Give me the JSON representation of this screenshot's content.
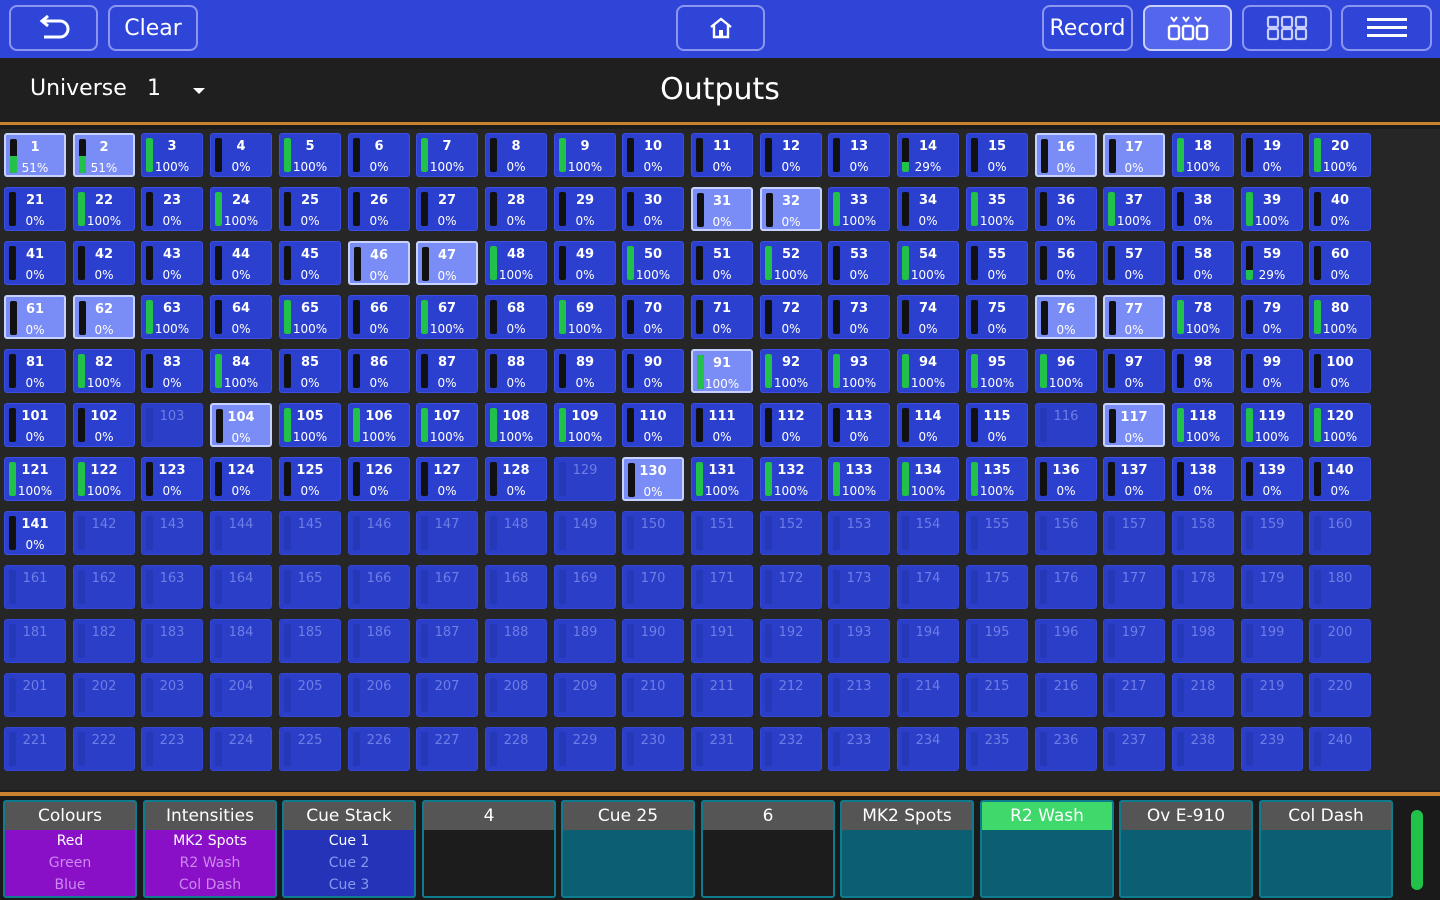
{
  "toolbar": {
    "clear_label": "Clear",
    "record_label": "Record"
  },
  "header": {
    "universe_label": "Universe",
    "universe_value": "1",
    "title": "Outputs"
  },
  "colors": {
    "toolbar": "#2f45d8",
    "cell": "#2c40cf",
    "cell_highlight": "#7a8cf5",
    "level_fill": "#22c24a",
    "accent_line": "#c9822f",
    "playback_teal": "#0c5f72",
    "playback_purple": "#8a10c8",
    "playback_blue": "#2433b8",
    "playback_active_header": "#3fd86a"
  },
  "channels": [
    {
      "n": "1",
      "p": "51%",
      "l": 0.51,
      "h": true
    },
    {
      "n": "2",
      "p": "51%",
      "l": 0.51,
      "h": true
    },
    {
      "n": "3",
      "p": "100%",
      "l": 1
    },
    {
      "n": "4",
      "p": "0%",
      "l": 0
    },
    {
      "n": "5",
      "p": "100%",
      "l": 1
    },
    {
      "n": "6",
      "p": "0%",
      "l": 0
    },
    {
      "n": "7",
      "p": "100%",
      "l": 1
    },
    {
      "n": "8",
      "p": "0%",
      "l": 0
    },
    {
      "n": "9",
      "p": "100%",
      "l": 1
    },
    {
      "n": "10",
      "p": "0%",
      "l": 0
    },
    {
      "n": "11",
      "p": "0%",
      "l": 0
    },
    {
      "n": "12",
      "p": "0%",
      "l": 0
    },
    {
      "n": "13",
      "p": "0%",
      "l": 0
    },
    {
      "n": "14",
      "p": "29%",
      "l": 0.29
    },
    {
      "n": "15",
      "p": "0%",
      "l": 0
    },
    {
      "n": "16",
      "p": "0%",
      "l": 0,
      "h": true
    },
    {
      "n": "17",
      "p": "0%",
      "l": 0,
      "h": true
    },
    {
      "n": "18",
      "p": "100%",
      "l": 1
    },
    {
      "n": "19",
      "p": "0%",
      "l": 0
    },
    {
      "n": "20",
      "p": "100%",
      "l": 1
    },
    {
      "n": "21",
      "p": "0%",
      "l": 0
    },
    {
      "n": "22",
      "p": "100%",
      "l": 1
    },
    {
      "n": "23",
      "p": "0%",
      "l": 0
    },
    {
      "n": "24",
      "p": "100%",
      "l": 1
    },
    {
      "n": "25",
      "p": "0%",
      "l": 0
    },
    {
      "n": "26",
      "p": "0%",
      "l": 0
    },
    {
      "n": "27",
      "p": "0%",
      "l": 0
    },
    {
      "n": "28",
      "p": "0%",
      "l": 0
    },
    {
      "n": "29",
      "p": "0%",
      "l": 0
    },
    {
      "n": "30",
      "p": "0%",
      "l": 0
    },
    {
      "n": "31",
      "p": "0%",
      "l": 0,
      "h": true
    },
    {
      "n": "32",
      "p": "0%",
      "l": 0,
      "h": true
    },
    {
      "n": "33",
      "p": "100%",
      "l": 1
    },
    {
      "n": "34",
      "p": "0%",
      "l": 0
    },
    {
      "n": "35",
      "p": "100%",
      "l": 1
    },
    {
      "n": "36",
      "p": "0%",
      "l": 0
    },
    {
      "n": "37",
      "p": "100%",
      "l": 1
    },
    {
      "n": "38",
      "p": "0%",
      "l": 0
    },
    {
      "n": "39",
      "p": "100%",
      "l": 1
    },
    {
      "n": "40",
      "p": "0%",
      "l": 0
    },
    {
      "n": "41",
      "p": "0%",
      "l": 0
    },
    {
      "n": "42",
      "p": "0%",
      "l": 0
    },
    {
      "n": "43",
      "p": "0%",
      "l": 0
    },
    {
      "n": "44",
      "p": "0%",
      "l": 0
    },
    {
      "n": "45",
      "p": "0%",
      "l": 0
    },
    {
      "n": "46",
      "p": "0%",
      "l": 0,
      "h": true
    },
    {
      "n": "47",
      "p": "0%",
      "l": 0,
      "h": true
    },
    {
      "n": "48",
      "p": "100%",
      "l": 1
    },
    {
      "n": "49",
      "p": "0%",
      "l": 0
    },
    {
      "n": "50",
      "p": "100%",
      "l": 1
    },
    {
      "n": "51",
      "p": "0%",
      "l": 0
    },
    {
      "n": "52",
      "p": "100%",
      "l": 1
    },
    {
      "n": "53",
      "p": "0%",
      "l": 0
    },
    {
      "n": "54",
      "p": "100%",
      "l": 1
    },
    {
      "n": "55",
      "p": "0%",
      "l": 0
    },
    {
      "n": "56",
      "p": "0%",
      "l": 0
    },
    {
      "n": "57",
      "p": "0%",
      "l": 0
    },
    {
      "n": "58",
      "p": "0%",
      "l": 0
    },
    {
      "n": "59",
      "p": "29%",
      "l": 0.29
    },
    {
      "n": "60",
      "p": "0%",
      "l": 0
    },
    {
      "n": "61",
      "p": "0%",
      "l": 0,
      "h": true
    },
    {
      "n": "62",
      "p": "0%",
      "l": 0,
      "h": true
    },
    {
      "n": "63",
      "p": "100%",
      "l": 1
    },
    {
      "n": "64",
      "p": "0%",
      "l": 0
    },
    {
      "n": "65",
      "p": "100%",
      "l": 1
    },
    {
      "n": "66",
      "p": "0%",
      "l": 0
    },
    {
      "n": "67",
      "p": "100%",
      "l": 1
    },
    {
      "n": "68",
      "p": "0%",
      "l": 0
    },
    {
      "n": "69",
      "p": "100%",
      "l": 1
    },
    {
      "n": "70",
      "p": "0%",
      "l": 0
    },
    {
      "n": "71",
      "p": "0%",
      "l": 0
    },
    {
      "n": "72",
      "p": "0%",
      "l": 0
    },
    {
      "n": "73",
      "p": "0%",
      "l": 0
    },
    {
      "n": "74",
      "p": "0%",
      "l": 0
    },
    {
      "n": "75",
      "p": "0%",
      "l": 0
    },
    {
      "n": "76",
      "p": "0%",
      "l": 0,
      "h": true
    },
    {
      "n": "77",
      "p": "0%",
      "l": 0,
      "h": true
    },
    {
      "n": "78",
      "p": "100%",
      "l": 1
    },
    {
      "n": "79",
      "p": "0%",
      "l": 0
    },
    {
      "n": "80",
      "p": "100%",
      "l": 1
    },
    {
      "n": "81",
      "p": "0%",
      "l": 0
    },
    {
      "n": "82",
      "p": "100%",
      "l": 1
    },
    {
      "n": "83",
      "p": "0%",
      "l": 0
    },
    {
      "n": "84",
      "p": "100%",
      "l": 1
    },
    {
      "n": "85",
      "p": "0%",
      "l": 0
    },
    {
      "n": "86",
      "p": "0%",
      "l": 0
    },
    {
      "n": "87",
      "p": "0%",
      "l": 0
    },
    {
      "n": "88",
      "p": "0%",
      "l": 0
    },
    {
      "n": "89",
      "p": "0%",
      "l": 0
    },
    {
      "n": "90",
      "p": "0%",
      "l": 0
    },
    {
      "n": "91",
      "p": "100%",
      "l": 1,
      "h": true
    },
    {
      "n": "92",
      "p": "100%",
      "l": 1
    },
    {
      "n": "93",
      "p": "100%",
      "l": 1
    },
    {
      "n": "94",
      "p": "100%",
      "l": 1
    },
    {
      "n": "95",
      "p": "100%",
      "l": 1
    },
    {
      "n": "96",
      "p": "100%",
      "l": 1
    },
    {
      "n": "97",
      "p": "0%",
      "l": 0
    },
    {
      "n": "98",
      "p": "0%",
      "l": 0
    },
    {
      "n": "99",
      "p": "0%",
      "l": 0
    },
    {
      "n": "100",
      "p": "0%",
      "l": 0
    },
    {
      "n": "101",
      "p": "0%",
      "l": 0
    },
    {
      "n": "102",
      "p": "0%",
      "l": 0
    },
    {
      "n": "103",
      "e": true
    },
    {
      "n": "104",
      "p": "0%",
      "l": 0,
      "h": true
    },
    {
      "n": "105",
      "p": "100%",
      "l": 1
    },
    {
      "n": "106",
      "p": "100%",
      "l": 1
    },
    {
      "n": "107",
      "p": "100%",
      "l": 1
    },
    {
      "n": "108",
      "p": "100%",
      "l": 1
    },
    {
      "n": "109",
      "p": "100%",
      "l": 1
    },
    {
      "n": "110",
      "p": "0%",
      "l": 0
    },
    {
      "n": "111",
      "p": "0%",
      "l": 0
    },
    {
      "n": "112",
      "p": "0%",
      "l": 0
    },
    {
      "n": "113",
      "p": "0%",
      "l": 0
    },
    {
      "n": "114",
      "p": "0%",
      "l": 0
    },
    {
      "n": "115",
      "p": "0%",
      "l": 0
    },
    {
      "n": "116",
      "e": true
    },
    {
      "n": "117",
      "p": "0%",
      "l": 0,
      "h": true
    },
    {
      "n": "118",
      "p": "100%",
      "l": 1
    },
    {
      "n": "119",
      "p": "100%",
      "l": 1
    },
    {
      "n": "120",
      "p": "100%",
      "l": 1
    },
    {
      "n": "121",
      "p": "100%",
      "l": 1
    },
    {
      "n": "122",
      "p": "100%",
      "l": 1
    },
    {
      "n": "123",
      "p": "0%",
      "l": 0
    },
    {
      "n": "124",
      "p": "0%",
      "l": 0
    },
    {
      "n": "125",
      "p": "0%",
      "l": 0
    },
    {
      "n": "126",
      "p": "0%",
      "l": 0
    },
    {
      "n": "127",
      "p": "0%",
      "l": 0
    },
    {
      "n": "128",
      "p": "0%",
      "l": 0
    },
    {
      "n": "129",
      "e": true
    },
    {
      "n": "130",
      "p": "0%",
      "l": 0,
      "h": true
    },
    {
      "n": "131",
      "p": "100%",
      "l": 1
    },
    {
      "n": "132",
      "p": "100%",
      "l": 1
    },
    {
      "n": "133",
      "p": "100%",
      "l": 1
    },
    {
      "n": "134",
      "p": "100%",
      "l": 1
    },
    {
      "n": "135",
      "p": "100%",
      "l": 1
    },
    {
      "n": "136",
      "p": "0%",
      "l": 0
    },
    {
      "n": "137",
      "p": "0%",
      "l": 0
    },
    {
      "n": "138",
      "p": "0%",
      "l": 0
    },
    {
      "n": "139",
      "p": "0%",
      "l": 0
    },
    {
      "n": "140",
      "p": "0%",
      "l": 0
    },
    {
      "n": "141",
      "p": "0%",
      "l": 0
    },
    {
      "n": "142",
      "e": true
    },
    {
      "n": "143",
      "e": true
    },
    {
      "n": "144",
      "e": true
    },
    {
      "n": "145",
      "e": true
    },
    {
      "n": "146",
      "e": true
    },
    {
      "n": "147",
      "e": true
    },
    {
      "n": "148",
      "e": true
    },
    {
      "n": "149",
      "e": true
    },
    {
      "n": "150",
      "e": true
    },
    {
      "n": "151",
      "e": true
    },
    {
      "n": "152",
      "e": true
    },
    {
      "n": "153",
      "e": true
    },
    {
      "n": "154",
      "e": true
    },
    {
      "n": "155",
      "e": true
    },
    {
      "n": "156",
      "e": true
    },
    {
      "n": "157",
      "e": true
    },
    {
      "n": "158",
      "e": true
    },
    {
      "n": "159",
      "e": true
    },
    {
      "n": "160",
      "e": true
    },
    {
      "n": "161",
      "e": true
    },
    {
      "n": "162",
      "e": true
    },
    {
      "n": "163",
      "e": true
    },
    {
      "n": "164",
      "e": true
    },
    {
      "n": "165",
      "e": true
    },
    {
      "n": "166",
      "e": true
    },
    {
      "n": "167",
      "e": true
    },
    {
      "n": "168",
      "e": true
    },
    {
      "n": "169",
      "e": true
    },
    {
      "n": "170",
      "e": true
    },
    {
      "n": "171",
      "e": true
    },
    {
      "n": "172",
      "e": true
    },
    {
      "n": "173",
      "e": true
    },
    {
      "n": "174",
      "e": true
    },
    {
      "n": "175",
      "e": true
    },
    {
      "n": "176",
      "e": true
    },
    {
      "n": "177",
      "e": true
    },
    {
      "n": "178",
      "e": true
    },
    {
      "n": "179",
      "e": true
    },
    {
      "n": "180",
      "e": true
    },
    {
      "n": "181",
      "e": true
    },
    {
      "n": "182",
      "e": true
    },
    {
      "n": "183",
      "e": true
    },
    {
      "n": "184",
      "e": true
    },
    {
      "n": "185",
      "e": true
    },
    {
      "n": "186",
      "e": true
    },
    {
      "n": "187",
      "e": true
    },
    {
      "n": "188",
      "e": true
    },
    {
      "n": "189",
      "e": true
    },
    {
      "n": "190",
      "e": true
    },
    {
      "n": "191",
      "e": true
    },
    {
      "n": "192",
      "e": true
    },
    {
      "n": "193",
      "e": true
    },
    {
      "n": "194",
      "e": true
    },
    {
      "n": "195",
      "e": true
    },
    {
      "n": "196",
      "e": true
    },
    {
      "n": "197",
      "e": true
    },
    {
      "n": "198",
      "e": true
    },
    {
      "n": "199",
      "e": true
    },
    {
      "n": "200",
      "e": true
    },
    {
      "n": "201",
      "e": true
    },
    {
      "n": "202",
      "e": true
    },
    {
      "n": "203",
      "e": true
    },
    {
      "n": "204",
      "e": true
    },
    {
      "n": "205",
      "e": true
    },
    {
      "n": "206",
      "e": true
    },
    {
      "n": "207",
      "e": true
    },
    {
      "n": "208",
      "e": true
    },
    {
      "n": "209",
      "e": true
    },
    {
      "n": "210",
      "e": true
    },
    {
      "n": "211",
      "e": true
    },
    {
      "n": "212",
      "e": true
    },
    {
      "n": "213",
      "e": true
    },
    {
      "n": "214",
      "e": true
    },
    {
      "n": "215",
      "e": true
    },
    {
      "n": "216",
      "e": true
    },
    {
      "n": "217",
      "e": true
    },
    {
      "n": "218",
      "e": true
    },
    {
      "n": "219",
      "e": true
    },
    {
      "n": "220",
      "e": true
    },
    {
      "n": "221",
      "e": true
    },
    {
      "n": "222",
      "e": true
    },
    {
      "n": "223",
      "e": true
    },
    {
      "n": "224",
      "e": true
    },
    {
      "n": "225",
      "e": true
    },
    {
      "n": "226",
      "e": true
    },
    {
      "n": "227",
      "e": true
    },
    {
      "n": "228",
      "e": true
    },
    {
      "n": "229",
      "e": true
    },
    {
      "n": "230",
      "e": true
    },
    {
      "n": "231",
      "e": true
    },
    {
      "n": "232",
      "e": true
    },
    {
      "n": "233",
      "e": true
    },
    {
      "n": "234",
      "e": true
    },
    {
      "n": "235",
      "e": true
    },
    {
      "n": "236",
      "e": true
    },
    {
      "n": "237",
      "e": true
    },
    {
      "n": "238",
      "e": true
    },
    {
      "n": "239",
      "e": true
    },
    {
      "n": "240",
      "e": true
    }
  ],
  "playbacks": [
    {
      "title": "Colours",
      "style": "purple",
      "items": [
        "Red",
        "Green",
        "Blue"
      ]
    },
    {
      "title": "Intensities",
      "style": "purple",
      "items": [
        "MK2 Spots",
        "R2 Wash",
        "Col Dash"
      ]
    },
    {
      "title": "Cue Stack",
      "style": "blue",
      "items": [
        "Cue 1",
        "Cue 2",
        "Cue 3"
      ]
    },
    {
      "title": "4",
      "style": "dark",
      "items": []
    },
    {
      "title": "Cue 25",
      "style": "teal",
      "items": []
    },
    {
      "title": "6",
      "style": "dark",
      "items": []
    },
    {
      "title": "MK2 Spots",
      "style": "teal",
      "items": []
    },
    {
      "title": "R2 Wash",
      "style": "teal",
      "active": true,
      "items": []
    },
    {
      "title": "Ov E-910",
      "style": "teal",
      "items": []
    },
    {
      "title": "Col Dash",
      "style": "teal",
      "items": []
    }
  ]
}
